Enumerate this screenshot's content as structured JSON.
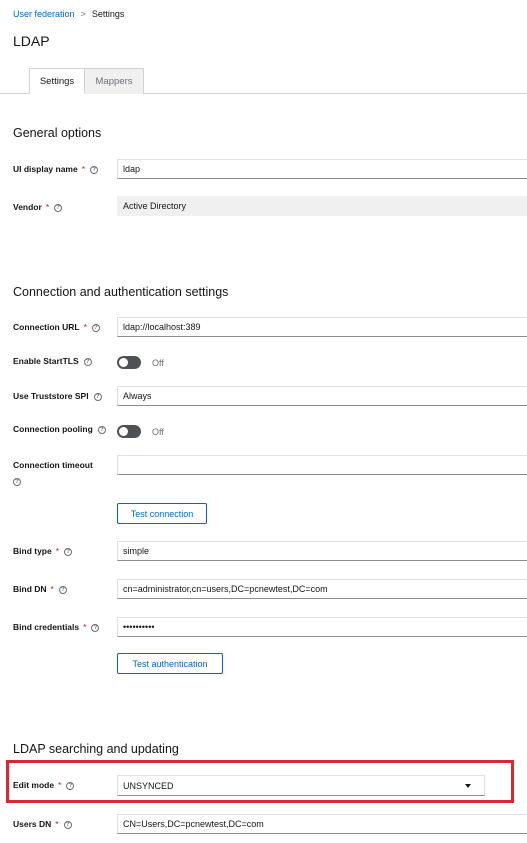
{
  "breadcrumb": {
    "parent": "User federation",
    "separator": ">",
    "current": "Settings"
  },
  "page": {
    "title": "LDAP"
  },
  "tabs": [
    {
      "label": "Settings",
      "active": true
    },
    {
      "label": "Mappers",
      "active": false
    }
  ],
  "general": {
    "title": "General options",
    "ui_display_name": {
      "label": "UI display name",
      "required": "*",
      "value": "ldap"
    },
    "vendor": {
      "label": "Vendor",
      "required": "*",
      "value": "Active Directory"
    }
  },
  "connection": {
    "title": "Connection and authentication settings",
    "connection_url": {
      "label": "Connection URL",
      "required": "*",
      "value": "ldap://localhost:389"
    },
    "enable_starttls": {
      "label": "Enable StartTLS",
      "state": "Off"
    },
    "use_truststore_spi": {
      "label": "Use Truststore SPI",
      "value": "Always"
    },
    "connection_pooling": {
      "label": "Connection pooling",
      "state": "Off"
    },
    "connection_timeout": {
      "label": "Connection timeout",
      "value": ""
    },
    "test_connection_label": "Test connection",
    "bind_type": {
      "label": "Bind type",
      "required": "*",
      "value": "simple"
    },
    "bind_dn": {
      "label": "Bind DN",
      "required": "*",
      "value": "cn=administrator,cn=users,DC=pcnewtest,DC=com"
    },
    "bind_credentials": {
      "label": "Bind credentials",
      "required": "*",
      "value": "••••••••••"
    },
    "test_authentication_label": "Test authentication"
  },
  "searching": {
    "title": "LDAP searching and updating",
    "edit_mode": {
      "label": "Edit mode",
      "required": "*",
      "value": "UNSYNCED"
    },
    "users_dn": {
      "label": "Users DN",
      "required": "*",
      "value": "CN=Users,DC=pcnewtest,DC=com"
    }
  },
  "icons": {
    "help": "help-circle-icon",
    "dropdown": "caret-down-icon"
  },
  "colors": {
    "link": "#0066cc",
    "required": "#c9190b",
    "highlight": "#d9262f",
    "toggle_off": "#4f5255"
  }
}
